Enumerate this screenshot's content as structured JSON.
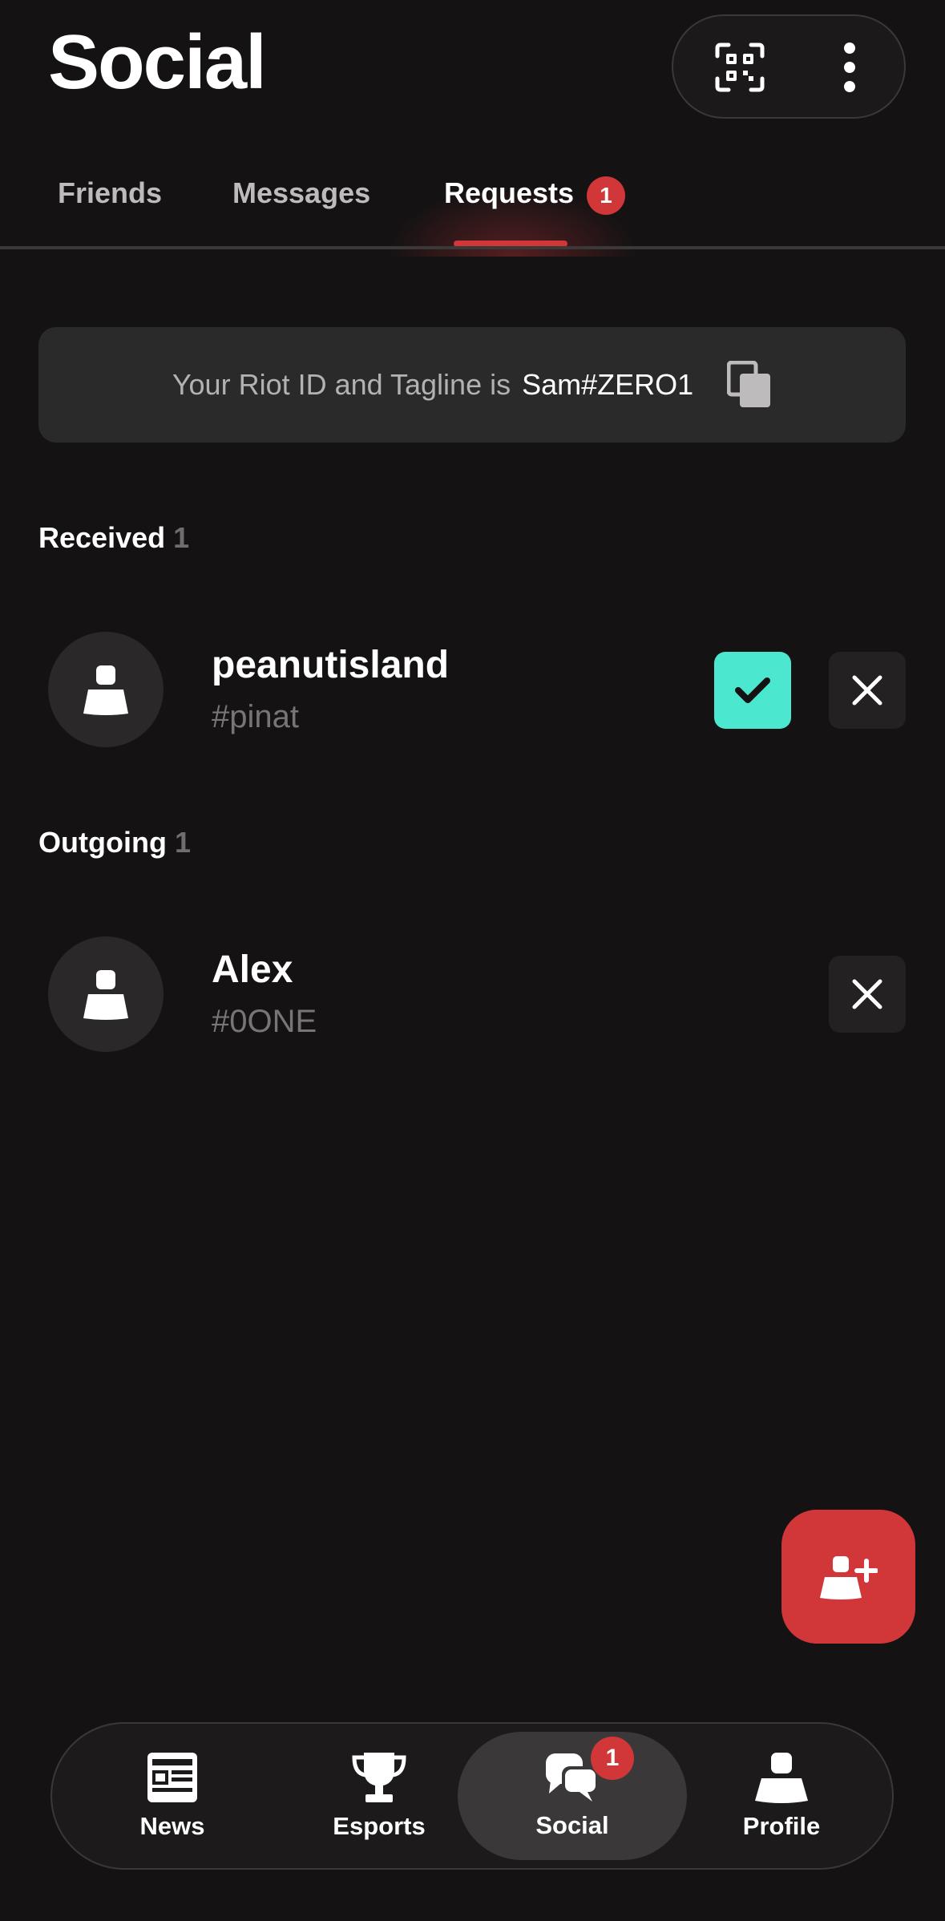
{
  "header": {
    "title": "Social",
    "qr_icon": "qr-code-icon",
    "more_icon": "more-vertical-icon"
  },
  "tabs": [
    {
      "label": "Friends",
      "active": false
    },
    {
      "label": "Messages",
      "active": false
    },
    {
      "label": "Requests",
      "active": true,
      "badge": "1"
    }
  ],
  "riot_id": {
    "prefix": "Your Riot ID and Tagline is",
    "value": "Sam#ZERO1",
    "icon": "copy-icon"
  },
  "received": {
    "label": "Received",
    "count": "1",
    "items": [
      {
        "name": "peanutisland",
        "tag": "#pinat",
        "accept_icon": "check-icon",
        "decline_icon": "close-icon"
      }
    ]
  },
  "outgoing": {
    "label": "Outgoing",
    "count": "1",
    "items": [
      {
        "name": "Alex",
        "tag": "#0ONE",
        "decline_icon": "close-icon"
      }
    ]
  },
  "fab": {
    "icon": "add-friend-icon"
  },
  "bottom_nav": [
    {
      "label": "News",
      "icon": "newspaper-icon",
      "active": false
    },
    {
      "label": "Esports",
      "icon": "trophy-icon",
      "active": false
    },
    {
      "label": "Social",
      "icon": "chat-bubbles-icon",
      "active": true,
      "badge": "1"
    },
    {
      "label": "Profile",
      "icon": "person-icon",
      "active": false
    }
  ],
  "colors": {
    "background": "#141213",
    "accent_red": "#d13639",
    "accept_teal": "#4be8cf",
    "card": "#2b2a2b"
  }
}
